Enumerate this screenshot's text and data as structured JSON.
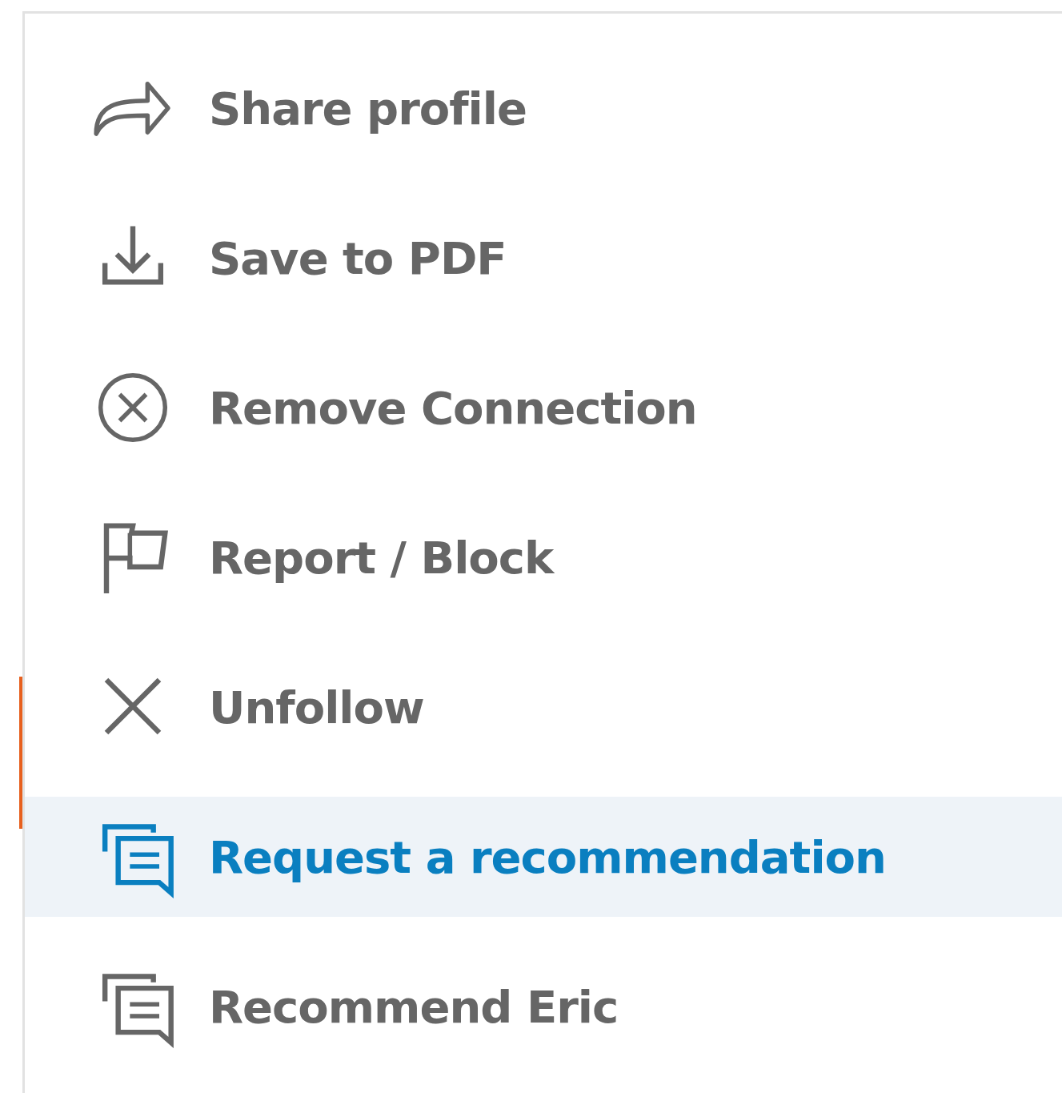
{
  "menu": {
    "items": [
      {
        "label": "Share profile",
        "selected": false
      },
      {
        "label": "Save to PDF",
        "selected": false
      },
      {
        "label": "Remove Connection",
        "selected": false
      },
      {
        "label": "Report / Block",
        "selected": false
      },
      {
        "label": "Unfollow",
        "selected": false
      },
      {
        "label": "Request a recommendation",
        "selected": true
      },
      {
        "label": "Recommend Eric",
        "selected": false
      }
    ]
  }
}
